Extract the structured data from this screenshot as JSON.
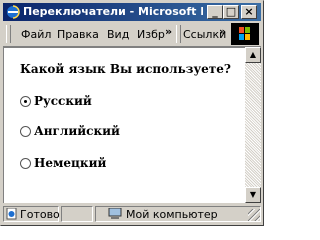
{
  "window": {
    "title": "Переключатели - Microsoft Internet Explorer"
  },
  "titlebar_buttons": {
    "minimize": "_",
    "maximize": "□",
    "close": "×"
  },
  "menubar": {
    "items": [
      "Файл",
      "Правка",
      "Вид",
      "Избр"
    ],
    "overflow": "»",
    "links_label": "Ссылки",
    "links_overflow": "»"
  },
  "page": {
    "question": "Какой язык Вы используете?",
    "options": [
      {
        "label": "Русский",
        "selected": true
      },
      {
        "label": "Английский",
        "selected": false
      },
      {
        "label": "Немецкий",
        "selected": false
      }
    ]
  },
  "statusbar": {
    "status": "Готово",
    "zone": "Мой компьютер"
  },
  "colors": {
    "titlebar": "#0a246a",
    "chrome": "#d4d0c8"
  }
}
